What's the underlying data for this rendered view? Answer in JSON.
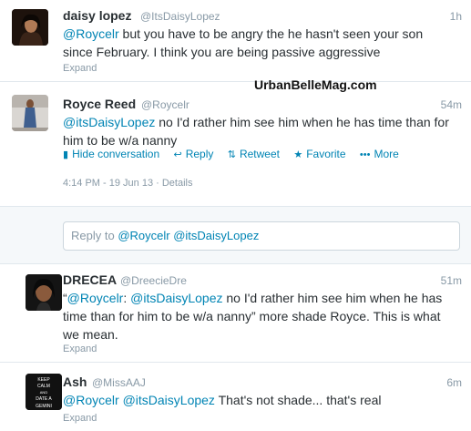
{
  "tweets": [
    {
      "name": "daisy lopez",
      "handle": "@ItsDaisyLopez",
      "time": "1h",
      "text_mention": "@Roycelr",
      "text_line1_rest": " but you have to be angry the he hasn't seen your son",
      "text_line2": "since February. I think you are being passive aggressive",
      "expand": "Expand"
    },
    {
      "name": "Royce Reed",
      "handle": "@Roycelr",
      "time": "54m",
      "text_mention": "@itsDaisyLopez",
      "text_line1_rest": " no I'd rather him see him when he has time than for",
      "text_line2": "him to be w/a nanny",
      "actions": {
        "hide": "Hide conversation",
        "reply": "Reply",
        "retweet": "Retweet",
        "favorite": "Favorite",
        "more": "More"
      },
      "timestamp": "4:14 PM - 19 Jun 13",
      "details": "Details"
    },
    {
      "name": "DRECEA",
      "handle": "@DreecieDre",
      "time": "51m",
      "text_open": "“",
      "text_mention1": "@Roycelr",
      "text_colon": ": ",
      "text_mention2": "@itsDaisyLopez",
      "text_line1_rest": " no I'd rather him see him when he has",
      "text_line2": "time than for him to be w/a nanny” more shade Royce. This is what",
      "text_line3": "we mean.",
      "expand": "Expand"
    },
    {
      "name": "Ash",
      "handle": "@MissAAJ",
      "time": "6m",
      "text_mention1": "@Roycelr",
      "text_mention2": "@itsDaisyLopez",
      "text_rest": " That's not shade... that's real",
      "expand": "Expand",
      "avatar_text": [
        "KEEP",
        "CALM",
        "AND",
        "DATE A",
        "GEMINI"
      ]
    }
  ],
  "reply_box": {
    "prefix": "Reply to ",
    "mention1": "@Roycelr",
    "mention2": "@itsDaisyLopez"
  },
  "watermark": "UrbanBelleMag.com",
  "colors": {
    "link": "#0084b4",
    "muted": "#8899a6",
    "text": "#292f33"
  }
}
